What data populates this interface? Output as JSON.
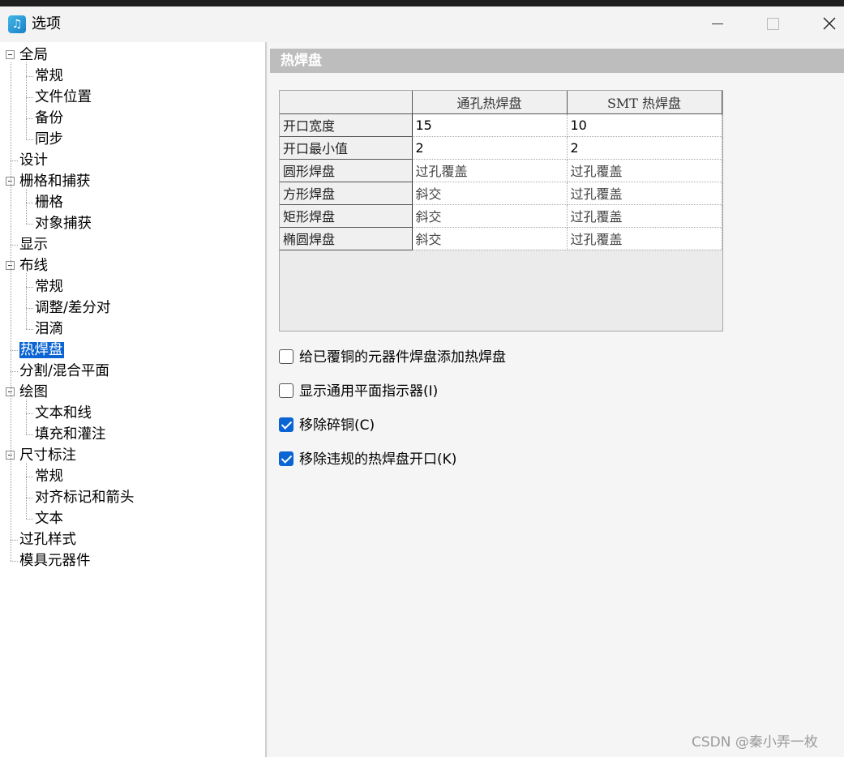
{
  "window": {
    "title": "选项"
  },
  "tree": [
    {
      "label": "全局",
      "level": 0,
      "expanded": true
    },
    {
      "label": "常规",
      "level": 1
    },
    {
      "label": "文件位置",
      "level": 1
    },
    {
      "label": "备份",
      "level": 1
    },
    {
      "label": "同步",
      "level": 1
    },
    {
      "label": "设计",
      "level": 0
    },
    {
      "label": "栅格和捕获",
      "level": 0,
      "expanded": true
    },
    {
      "label": "栅格",
      "level": 1
    },
    {
      "label": "对象捕获",
      "level": 1
    },
    {
      "label": "显示",
      "level": 0
    },
    {
      "label": "布线",
      "level": 0,
      "expanded": true
    },
    {
      "label": "常规",
      "level": 1
    },
    {
      "label": "调整/差分对",
      "level": 1
    },
    {
      "label": "泪滴",
      "level": 1
    },
    {
      "label": "热焊盘",
      "level": 0,
      "selected": true
    },
    {
      "label": "分割/混合平面",
      "level": 0
    },
    {
      "label": "绘图",
      "level": 0,
      "expanded": true
    },
    {
      "label": "文本和线",
      "level": 1
    },
    {
      "label": "填充和灌注",
      "level": 1
    },
    {
      "label": "尺寸标注",
      "level": 0,
      "expanded": true
    },
    {
      "label": "常规",
      "level": 1
    },
    {
      "label": "对齐标记和箭头",
      "level": 1
    },
    {
      "label": "文本",
      "level": 1
    },
    {
      "label": "过孔样式",
      "level": 0
    },
    {
      "label": "模具元器件",
      "level": 0
    }
  ],
  "panel": {
    "title": "热焊盘"
  },
  "grid": {
    "columns": [
      "通孔热焊盘",
      "SMT 热焊盘"
    ],
    "rows": [
      {
        "label": "开口宽度",
        "values": [
          "15",
          "10"
        ]
      },
      {
        "label": "开口最小值",
        "values": [
          "2",
          "2"
        ]
      },
      {
        "label": "圆形焊盘",
        "values": [
          "过孔覆盖",
          "过孔覆盖"
        ]
      },
      {
        "label": "方形焊盘",
        "values": [
          "斜交",
          "过孔覆盖"
        ]
      },
      {
        "label": "矩形焊盘",
        "values": [
          "斜交",
          "过孔覆盖"
        ]
      },
      {
        "label": "椭圆焊盘",
        "values": [
          "斜交",
          "过孔覆盖"
        ]
      }
    ]
  },
  "options": [
    {
      "label": "给已覆铜的元器件焊盘添加热焊盘",
      "checked": false
    },
    {
      "label": "显示通用平面指示器(I)",
      "checked": false
    },
    {
      "label": "移除碎铜(C)",
      "checked": true
    },
    {
      "label": "移除违规的热焊盘开口(K)",
      "checked": true
    }
  ],
  "watermark": "CSDN @秦小弄一枚",
  "colors": {
    "selection": "#0a64d4",
    "header_bg": "#bdbdbd"
  }
}
